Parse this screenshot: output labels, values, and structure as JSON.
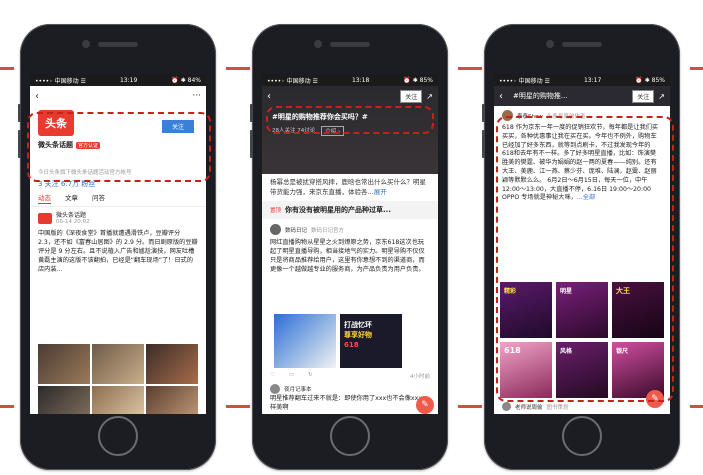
{
  "status_bar": {
    "p1": {
      "carrier": "••••◦ 中国移动 ☰",
      "time": "13:19",
      "battery": "⏰ ✱ 84%"
    },
    "p2": {
      "carrier": "••••◦ 中国移动 ☰",
      "time": "13:18",
      "battery": "⏰ ✱ 85%"
    },
    "p3": {
      "carrier": "••••◦ 中国移动 ☰",
      "time": "13:17",
      "battery": "⏰ ✱ 85%"
    }
  },
  "phone1": {
    "logo_text": "头条",
    "follow": "关注",
    "name": "微头条话题",
    "badge": "官方认证",
    "desc": "今日头条旗下微头条话题活动官方帐号",
    "stats": "3 关注  6.7万 粉丝",
    "tabs": [
      "动态",
      "文章",
      "问答"
    ],
    "post_author": "微头条话题",
    "post_date": "06-14 20:02",
    "post_text": "中国版的《深夜食堂》首播就遭遇滑铁卢，豆瓣评分 2.3，还不如《富春山居图》的 2.9 分。而日剧原版的豆瓣评分是 9 分左右。且不说植入广告和尴尬演技，网友吐槽黄磊主演的这版不该翻拍，已经是“翻车现场”了！日式的店内装..."
  },
  "phone2": {
    "follow": "关注",
    "topic_title": "#明星的购物推荐你会买吗？#",
    "topic_stats": "28人关注  74讨论",
    "topic_intro": "介绍 ›",
    "lead_text": "杨幂总是被扰穿搭风摔，鹿晗也常出什么买什么？明星带货能力强，来京东直播，体验各...",
    "expand": "展开",
    "question_tag": "置顶",
    "question": "你有没有被明星用的产品种过草...",
    "author": "数码日记",
    "author_meta": "数码日记官方",
    "post_text": "网红直播购物从星星之火到燎原之势，京东618这次也玩起了明星直播导购，相当接地气的实力。明星导购不仅仅只是将商品推荐给用户，这里有你意想不到的渠道商，而更像一个越做越专业的服务商，为产品负责为用户负责。",
    "promo": [
      "打战忆环",
      "尊享好物",
      "618"
    ],
    "action_counts": "4小时前",
    "second_author": "夜月记事本",
    "second_text": "明星推荐翻车过来不就是：即使你用了xxx也不会像xxx一样美啊"
  },
  "phone3": {
    "follow": "关注",
    "title": "#明星的购物推...",
    "author": "泰泰Show",
    "author_meta": "头条号原创作者",
    "post_text": "618 作为京东一年一度的促销狂欢节，每年都是让我们买买买，各种优惠事让我在买在买。今年也不例外，购物车已经加了好多东西，就等到点刷卡，不过我发现今年的618和去年有不一样。多了好多明星直播，比如：饰演樊胜美的樊霆、被华为娟娟的赵一两的夏春——纯别。还有大王、美鹿、江一燕、蔡少芬、庞堆、陆澜，赵霙、赵丽颖等默默么么。 6月2日～6月15日，每天一位，中午 12:00～13:00，大直播不停，6.16日 19:00～20:00 OPPO 专场就是神秘大咪，",
    "full_link": "...全部",
    "images": [
      "精彩",
      "明星",
      "大王",
      "618",
      "风格",
      "银尺"
    ],
    "commenter": "老师说周偷",
    "comment_meta": "图书策划"
  }
}
